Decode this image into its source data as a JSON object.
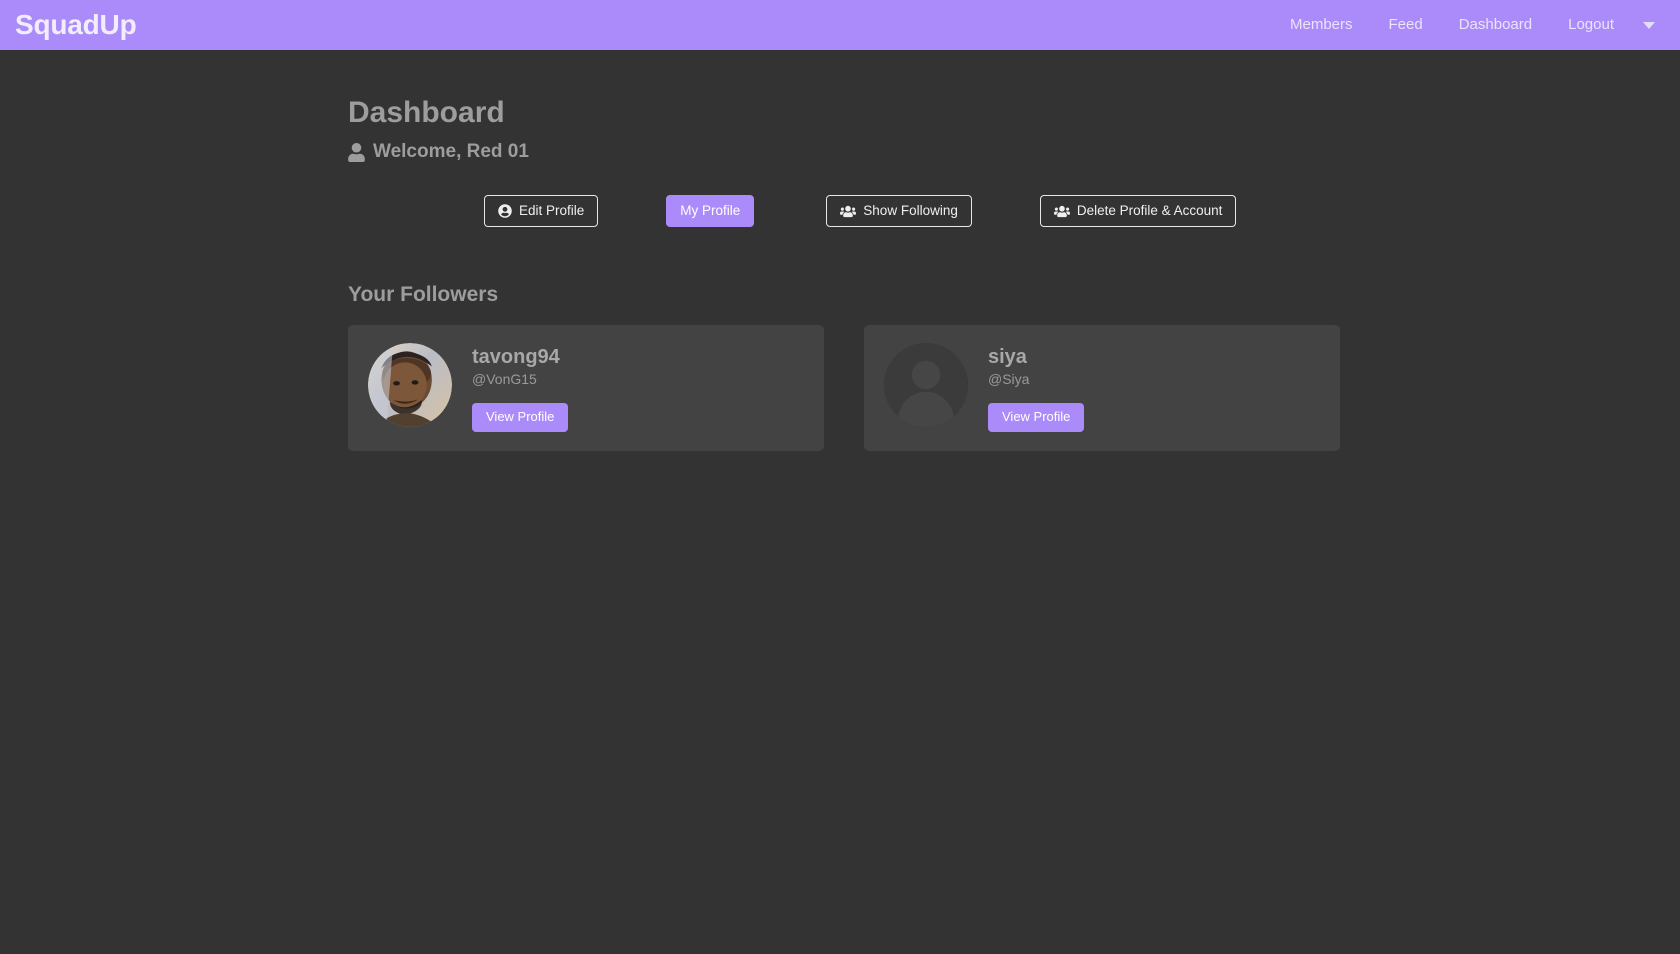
{
  "navbar": {
    "brand": "SquadUp",
    "links": [
      {
        "label": "Members",
        "name": "nav-link-members"
      },
      {
        "label": "Feed",
        "name": "nav-link-feed"
      },
      {
        "label": "Dashboard",
        "name": "nav-link-dashboard"
      },
      {
        "label": "Logout",
        "name": "nav-link-logout"
      }
    ],
    "caret_icon": "chevron-down-icon",
    "background_color": "#ab8bfa",
    "link_color": "#ebe3fb"
  },
  "header": {
    "page_title": "Dashboard",
    "welcome_text": "Welcome, Red 01",
    "welcome_icon": "user-icon"
  },
  "actions": {
    "edit_profile": {
      "label": "Edit Profile",
      "icon": "user-circle-icon",
      "style": "outline"
    },
    "my_profile": {
      "label": "My Profile",
      "icon": "none",
      "style": "purple"
    },
    "show_following": {
      "label": "Show Following",
      "icon": "users-icon",
      "style": "outline"
    },
    "delete_profile": {
      "label": "Delete Profile & Account",
      "icon": "users-icon",
      "style": "outline"
    }
  },
  "followers": {
    "section_title": "Your Followers",
    "view_profile_label": "View Profile",
    "items": [
      {
        "name": "tavong94",
        "handle": "@VonG15",
        "avatar_type": "photo",
        "avatar_icon": "profile-photo",
        "view_label": "View Profile"
      },
      {
        "name": "siya",
        "handle": "@Siya",
        "avatar_type": "placeholder",
        "avatar_icon": "default-avatar-icon",
        "view_label": "View Profile"
      }
    ]
  },
  "theme": {
    "page_background": "#333333",
    "card_background": "#434343",
    "accent": "#ab8bfa",
    "muted_text": "#9d9d9d"
  }
}
